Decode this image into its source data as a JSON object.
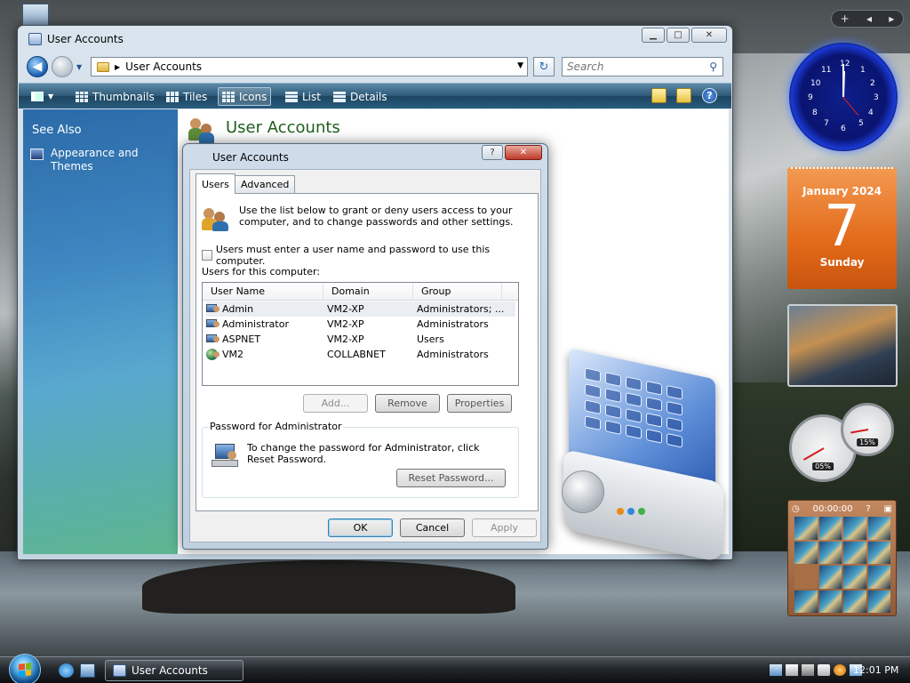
{
  "colors": {
    "accent": "#1e5e1e",
    "command_bar": "#2d5a78",
    "calendar": "#e36b1a",
    "clock_glow": "#3a66ff"
  },
  "window": {
    "title": "User Accounts",
    "address_path": "User Accounts",
    "search_placeholder": "Search",
    "toolbar": {
      "views_icon": "views-icon",
      "items": [
        {
          "label": "Thumbnails",
          "icon": "thumbnails-icon"
        },
        {
          "label": "Tiles",
          "icon": "tiles-icon"
        },
        {
          "label": "Icons",
          "icon": "icons-icon",
          "selected": true
        },
        {
          "label": "List",
          "icon": "list-icon"
        },
        {
          "label": "Details",
          "icon": "details-icon"
        }
      ]
    },
    "nav_pane": {
      "heading": "See Also",
      "links": [
        {
          "label": "Appearance and Themes",
          "icon": "monitor-icon"
        }
      ]
    },
    "content_title": "User Accounts"
  },
  "dialog": {
    "title": "User Accounts",
    "help_glyph": "?",
    "tabs": [
      {
        "label": "Users",
        "active": true
      },
      {
        "label": "Advanced",
        "active": false
      }
    ],
    "intro": "Use the list below to grant or deny users access to your computer, and to change passwords and other settings.",
    "checkbox_label": "Users must enter a user name and password to use this computer.",
    "checkbox_checked": false,
    "users_label": "Users for this computer:",
    "columns": [
      "User Name",
      "Domain",
      "Group"
    ],
    "users": [
      {
        "name": "Admin",
        "domain": "VM2-XP",
        "group": "Administrators; ...",
        "icon": "local-user-icon"
      },
      {
        "name": "Administrator",
        "domain": "VM2-XP",
        "group": "Administrators",
        "icon": "local-user-icon"
      },
      {
        "name": "ASPNET",
        "domain": "VM2-XP",
        "group": "Users",
        "icon": "local-user-icon"
      },
      {
        "name": "VM2",
        "domain": "COLLABNET",
        "group": "Administrators",
        "icon": "domain-user-icon"
      }
    ],
    "list_buttons": {
      "add": "Add...",
      "remove": "Remove",
      "properties": "Properties"
    },
    "password_group_title": "Password for Administrator",
    "password_text": "To change the password for Administrator, click Reset Password.",
    "reset_button": "Reset Password...",
    "footer": {
      "ok": "OK",
      "cancel": "Cancel",
      "apply": "Apply"
    }
  },
  "sidebar": {
    "controls": {
      "add": "+",
      "prev": "◂",
      "next": "▸"
    },
    "clock_numbers": [
      "12",
      "1",
      "2",
      "3",
      "4",
      "5",
      "6",
      "7",
      "8",
      "9",
      "10",
      "11"
    ],
    "calendar": {
      "month": "January 2024",
      "day": "7",
      "weekday": "Sunday"
    },
    "meters": {
      "cpu": "05%",
      "memory": "15%"
    },
    "puzzle_timer": "00:00:00"
  },
  "taskbar": {
    "task_label": "User Accounts",
    "time": "12:01 PM"
  }
}
